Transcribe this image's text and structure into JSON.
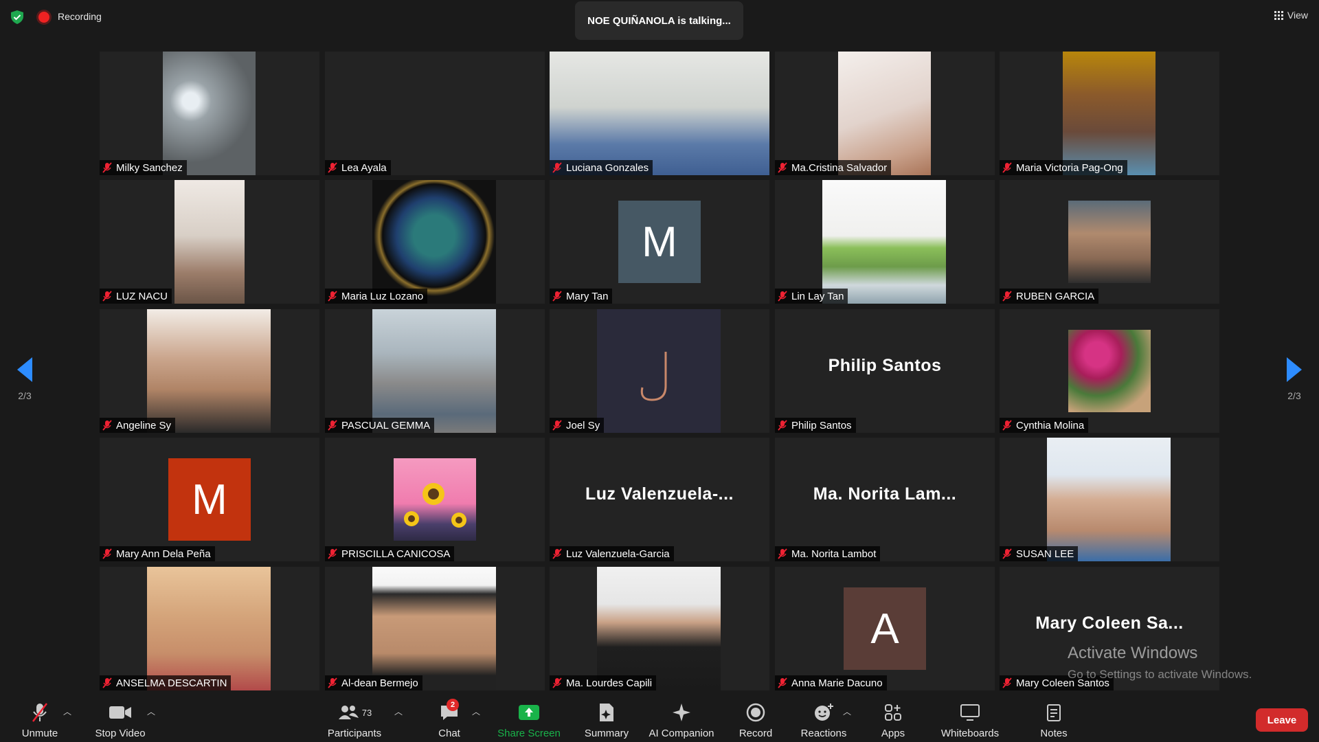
{
  "top_bar": {
    "recording_label": "Recording",
    "talking_banner": "NOE QUIÑANOLA is talking...",
    "view_label": "View"
  },
  "pagination": {
    "left_page": "2/3",
    "right_page": "2/3"
  },
  "participants": [
    {
      "name": "Milky Sanchez"
    },
    {
      "name": "Lea Ayala"
    },
    {
      "name": "Luciana Gonzales"
    },
    {
      "name": "Ma.Cristina Salvador"
    },
    {
      "name": "Maria Victoria Pag-Ong"
    },
    {
      "name": "LUZ NACU"
    },
    {
      "name": "Maria Luz Lozano"
    },
    {
      "name": "Mary Tan",
      "avatar_letter": "M",
      "avatar_color": "#465864"
    },
    {
      "name": "Lin Lay Tan"
    },
    {
      "name": "RUBEN GARCIA"
    },
    {
      "name": "Angeline Sy"
    },
    {
      "name": "PASCUAL GEMMA"
    },
    {
      "name": "Joel Sy"
    },
    {
      "name": "Philip Santos",
      "display_name": "Philip Santos"
    },
    {
      "name": "Cynthia Molina"
    },
    {
      "name": "Mary Ann Dela Peña",
      "avatar_letter": "M",
      "avatar_color": "#c2330e"
    },
    {
      "name": "PRISCILLA CANICOSA"
    },
    {
      "name": "Luz Valenzuela-Garcia",
      "display_name": "Luz  Valenzuela-..."
    },
    {
      "name": "Ma. Norita Lambot",
      "display_name": "Ma.  Norita  Lam..."
    },
    {
      "name": "SUSAN LEE"
    },
    {
      "name": "ANSELMA DESCARTIN"
    },
    {
      "name": "Al-dean Bermejo"
    },
    {
      "name": "Ma. Lourdes Capili"
    },
    {
      "name": "Anna Marie Dacuno",
      "avatar_letter": "A",
      "avatar_color": "#5a3d37"
    },
    {
      "name": "Mary Coleen Santos",
      "display_name": "Mary  Coleen  Sa..."
    }
  ],
  "watermark": {
    "title": "Activate Windows",
    "subtitle": "Go to Settings to activate Windows."
  },
  "toolbar": {
    "unmute": "Unmute",
    "stop_video": "Stop Video",
    "participants": "Participants",
    "participant_count": "73",
    "chat": "Chat",
    "chat_badge": "2",
    "share_screen": "Share Screen",
    "summary": "Summary",
    "ai_companion": "AI Companion",
    "record": "Record",
    "reactions": "Reactions",
    "apps": "Apps",
    "whiteboards": "Whiteboards",
    "notes": "Notes",
    "leave": "Leave"
  },
  "colors": {
    "accent_blue": "#2d8cff",
    "leave_red": "#d22b2b",
    "share_green": "#19b34a"
  }
}
